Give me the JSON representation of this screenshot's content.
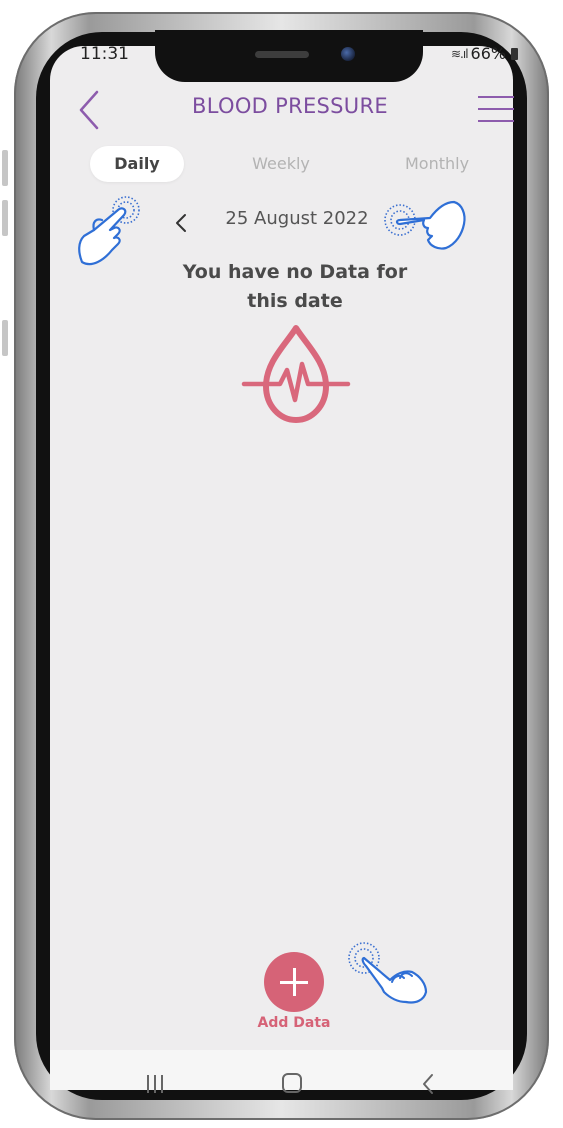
{
  "status_bar": {
    "time": "11:31",
    "battery": "66%"
  },
  "header": {
    "title": "BLOOD PRESSURE"
  },
  "tabs": [
    {
      "label": "Daily",
      "active": true
    },
    {
      "label": "Weekly",
      "active": false
    },
    {
      "label": "Monthly",
      "active": false
    }
  ],
  "date_nav": {
    "date": "25 August 2022"
  },
  "empty_state": {
    "line1": "You have no Data for",
    "line2": "this date",
    "icon": "blood-drop-pulse-icon"
  },
  "add": {
    "label": "Add Data"
  },
  "colors": {
    "accent_purple": "#7c4d9f",
    "accent_red": "#d66377",
    "screen_bg": "#eeedee",
    "hand_outline": "#2f6fd6"
  }
}
